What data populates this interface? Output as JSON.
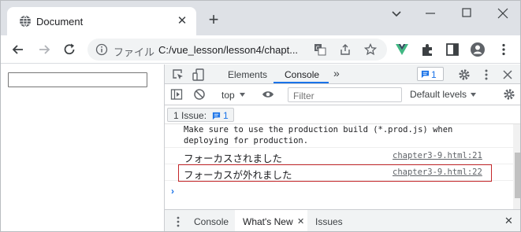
{
  "browser": {
    "tab_title": "Document",
    "tab_close": "✕",
    "new_tab": "+",
    "url_scheme": "ファイル",
    "url": "C:/vue_lesson/lesson4/chapt..."
  },
  "devtools": {
    "tabs": [
      "Elements",
      "Console"
    ],
    "more": "»",
    "issues_badge_count": "1",
    "context": "top",
    "filter_placeholder": "Filter",
    "levels": "Default levels",
    "issue_label": "1 Issue:",
    "issue_count": "1",
    "messages": {
      "warning_line1": "Make sure to use the production build (*.prod.js) when",
      "warning_line2": "deploying for production.",
      "logs": [
        {
          "text": "フォーカスされました",
          "source": "chapter3-9.html:21"
        },
        {
          "text": "フォーカスが外れました",
          "source": "chapter3-9.html:22"
        }
      ]
    },
    "prompt": "›",
    "drawer": {
      "tabs": [
        "Console",
        "What's New",
        "Issues"
      ],
      "close": "✕"
    }
  },
  "colors": {
    "accent": "#1a73e8",
    "highlight_border": "#c4272a",
    "vue_green": "#41b883"
  }
}
